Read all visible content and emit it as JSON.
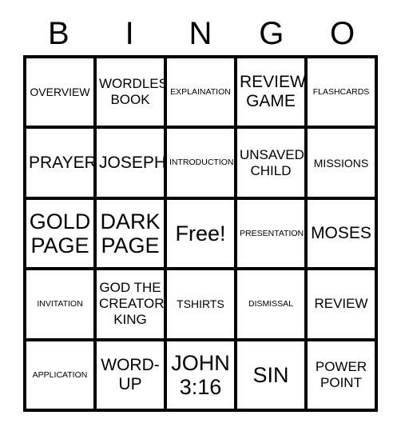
{
  "header": {
    "letters": [
      "B",
      "I",
      "N",
      "G",
      "O"
    ]
  },
  "grid": {
    "rows": 5,
    "columns": 5,
    "border_color": "#000000",
    "cell_background": "#ffffff",
    "text_color": "#000000",
    "cells": [
      {
        "text": "OVERVIEW",
        "size": "sm",
        "free": false
      },
      {
        "text": "WORDLES\nBOOK",
        "size": "md",
        "free": false
      },
      {
        "text": "EXPLAINATION",
        "size": "xs",
        "free": false
      },
      {
        "text": "REVIEW\nGAME",
        "size": "lg",
        "free": false
      },
      {
        "text": "FLASHCARDS",
        "size": "xs",
        "free": false
      },
      {
        "text": "PRAYER",
        "size": "lg",
        "free": false
      },
      {
        "text": "JOSEPH",
        "size": "lg",
        "free": false
      },
      {
        "text": "INTRODUCTION",
        "size": "xs",
        "free": false
      },
      {
        "text": "UNSAVED\nCHILD",
        "size": "md",
        "free": false
      },
      {
        "text": "MISSIONS",
        "size": "sm",
        "free": false
      },
      {
        "text": "GOLD\nPAGE",
        "size": "xl",
        "free": false
      },
      {
        "text": "DARK\nPAGE",
        "size": "xl",
        "free": false
      },
      {
        "text": "Free!",
        "size": "free",
        "free": true
      },
      {
        "text": "PRESENTATION",
        "size": "xs",
        "free": false
      },
      {
        "text": "MOSES",
        "size": "lg",
        "free": false
      },
      {
        "text": "INVITATION",
        "size": "xs",
        "free": false
      },
      {
        "text": "GOD THE\nCREATOR\nKING",
        "size": "md",
        "free": false
      },
      {
        "text": "TSHIRTS",
        "size": "sm",
        "free": false
      },
      {
        "text": "DISMISSAL",
        "size": "xs",
        "free": false
      },
      {
        "text": "REVIEW",
        "size": "md",
        "free": false
      },
      {
        "text": "APPLICATION",
        "size": "xs",
        "free": false
      },
      {
        "text": "WORD-\nUP",
        "size": "lg",
        "free": false
      },
      {
        "text": "JOHN\n3:16",
        "size": "xl",
        "free": false
      },
      {
        "text": "SIN",
        "size": "xl",
        "free": false
      },
      {
        "text": "POWER\nPOINT",
        "size": "md",
        "free": false
      }
    ]
  }
}
